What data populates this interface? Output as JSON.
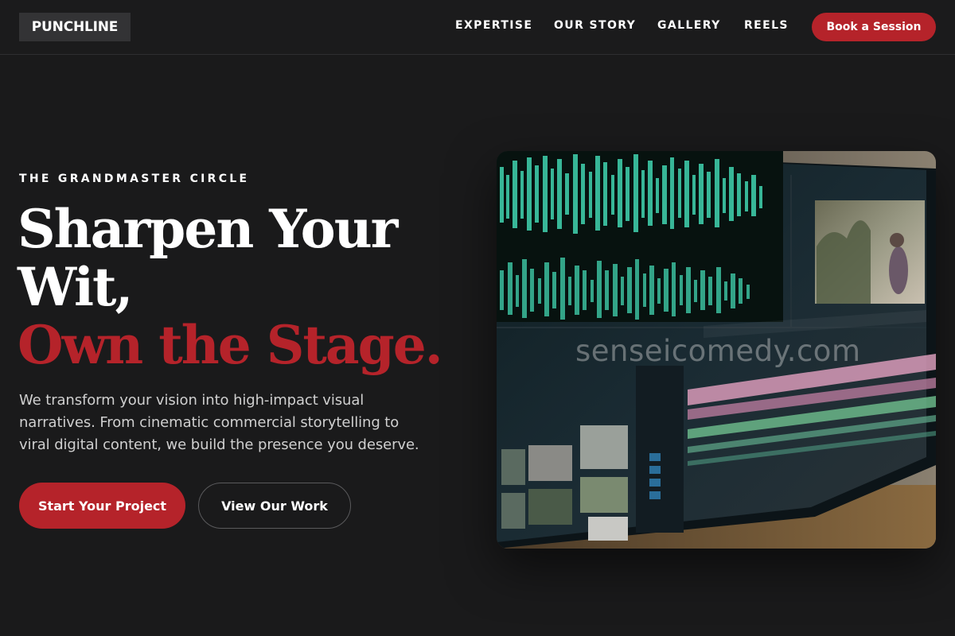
{
  "header": {
    "logo": "PUNCHLINE",
    "nav": [
      "EXPERTISE",
      "OUR STORY",
      "GALLERY",
      "REELS"
    ],
    "cta": "Book a Session"
  },
  "hero": {
    "eyebrow": "THE GRANDMASTER CIRCLE",
    "headline_line1": "Sharpen Your",
    "headline_line2": "Wit,",
    "headline_accent": "Own the Stage.",
    "lede": "We transform your vision into high-impact visual narratives. From cinematic commercial storytelling to viral digital content, we build the presence you deserve.",
    "primary_cta": "Start Your Project",
    "secondary_cta": "View Our Work",
    "image_watermark": "senseicomedy.com"
  },
  "colors": {
    "background": "#1a1a1b",
    "accent_red": "#b5232a",
    "logo_box": "#333335",
    "waveform_teal": "#3ec9a7"
  },
  "icons": {
    "hero_image": "video-editing-monitor-photo"
  }
}
